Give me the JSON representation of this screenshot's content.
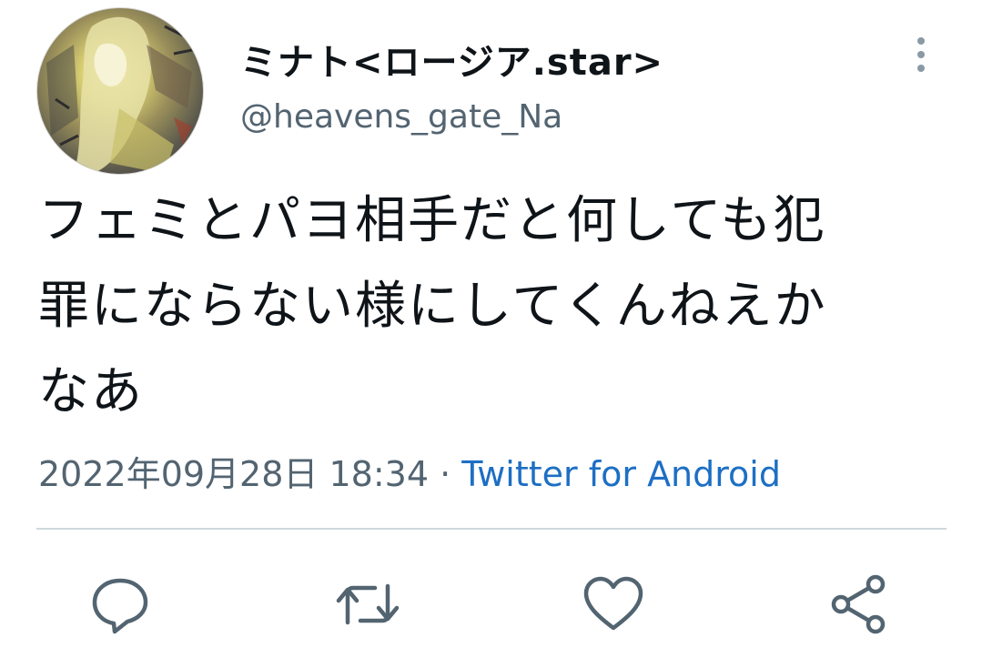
{
  "tweet": {
    "author": {
      "display_name": "ミナト<ロージア.star>",
      "handle": "@heavens_gate_Na"
    },
    "text": "フェミとパヨ相手だと何しても犯\n罪にならない様にしてくんねえか\nなあ",
    "timestamp": "2022年09月28日 18:34",
    "separator": "·",
    "source": "Twitter for Android"
  },
  "actions": [
    {
      "name": "reply",
      "icon": "reply-icon"
    },
    {
      "name": "retweet",
      "icon": "retweet-icon"
    },
    {
      "name": "like",
      "icon": "heart-icon"
    },
    {
      "name": "share",
      "icon": "share-icon"
    }
  ],
  "colors": {
    "text": "#0f1419",
    "secondary": "#536471",
    "link": "#1d6fc4",
    "divider": "#cfd9de"
  }
}
